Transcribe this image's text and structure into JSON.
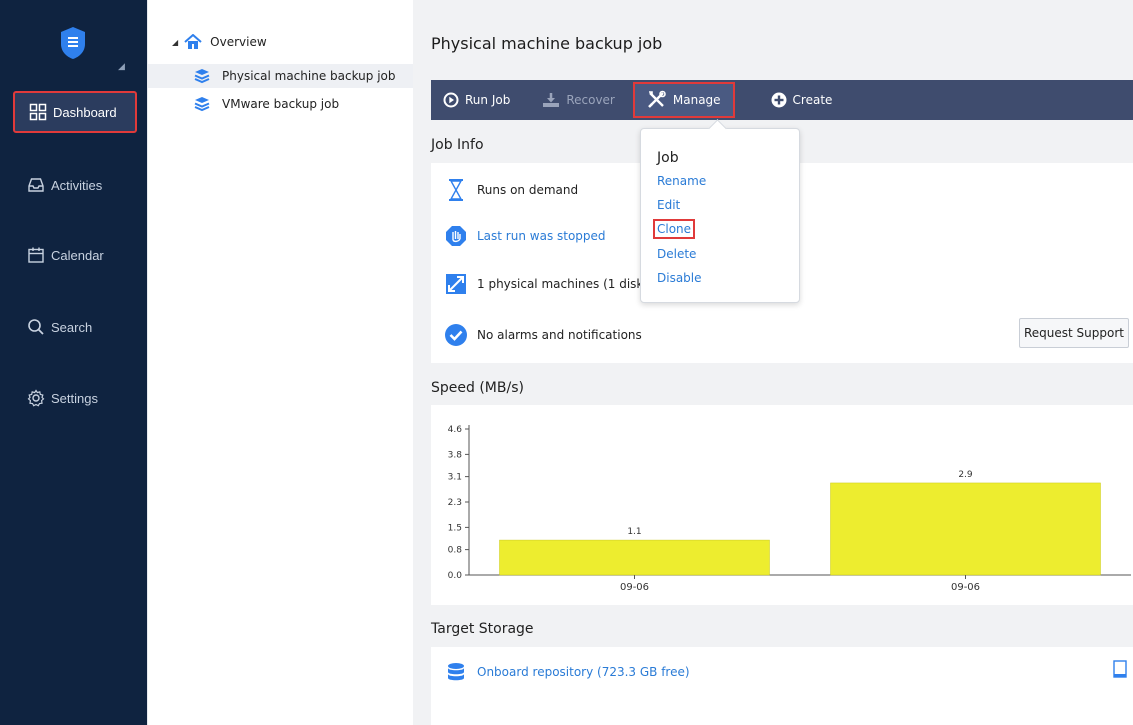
{
  "nav": {
    "items": [
      {
        "label": "Dashboard",
        "icon": "dashboard-icon"
      },
      {
        "label": "Activities",
        "icon": "inbox-icon"
      },
      {
        "label": "Calendar",
        "icon": "calendar-icon"
      },
      {
        "label": "Search",
        "icon": "search-icon"
      },
      {
        "label": "Settings",
        "icon": "gear-icon"
      }
    ]
  },
  "tree": {
    "root": "Overview",
    "jobs": [
      "Physical machine backup job",
      "VMware backup job"
    ]
  },
  "page": {
    "title": "Physical machine backup job"
  },
  "toolbar": {
    "run_job": "Run Job",
    "recover": "Recover",
    "manage": "Manage",
    "create": "Create"
  },
  "job_info": {
    "heading": "Job Info",
    "runs": "Runs on demand",
    "last_run": "Last run was stopped",
    "machines": "1 physical machines (1 disks,",
    "alarms": "No alarms and notifications",
    "request_support": "Request Support"
  },
  "menu": {
    "heading": "Job",
    "items": [
      "Rename",
      "Edit",
      "Clone",
      "Delete",
      "Disable"
    ]
  },
  "speed": {
    "heading": "Speed (MB/s)"
  },
  "storage": {
    "heading": "Target Storage",
    "repo": "Onboard repository (723.3 GB free)"
  },
  "chart_data": {
    "type": "bar",
    "categories": [
      "09-06",
      "09-06"
    ],
    "values": [
      1.1,
      2.9
    ],
    "yticks": [
      "4.6",
      "3.8",
      "3.1",
      "2.3",
      "1.5",
      "0.8",
      "0.0"
    ],
    "ylim": [
      0,
      4.6
    ],
    "bar_color": "#eded2f"
  },
  "colors": {
    "nav_bg": "#0f2340",
    "toolbar_bg": "#3f4c6e",
    "link": "#2a7bd6",
    "highlight": "#e03a3a"
  }
}
